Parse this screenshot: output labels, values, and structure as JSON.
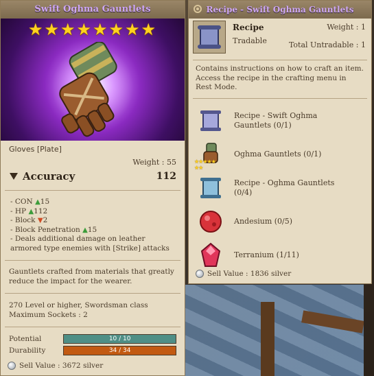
{
  "item": {
    "title": "Swift Oghma Gauntlets",
    "stars": "★★★★★★★★",
    "type": "Gloves [Plate]",
    "weight": "Weight : 55",
    "stat_name": "Accuracy",
    "stat_value": "112",
    "stats": [
      {
        "text": "- CON",
        "arrow": "▲",
        "dir": "up",
        "val": "15"
      },
      {
        "text": "- HP",
        "arrow": "▲",
        "dir": "up",
        "val": "112"
      },
      {
        "text": "- Block",
        "arrow": "▼",
        "dir": "down",
        "val": "2"
      },
      {
        "text": "- Block Penetration",
        "arrow": "▲",
        "dir": "up",
        "val": "15"
      }
    ],
    "stat_note": "- Deals additional damage on leather armored type enemies with [Strike] attacks",
    "description": "Gauntlets crafted from materials that greatly reduce the impact for the wearer.",
    "requirement": "270 Level or higher, Swordsman class",
    "sockets": "Maximum Sockets : 2",
    "potential_label": "Potential",
    "potential_value": "10 / 10",
    "potential_fraction": 1.0,
    "durability_label": "Durability",
    "durability_value": "34 / 34",
    "durability_fraction": 1.0,
    "sell_value": "Sell Value : 3672 silver"
  },
  "recipe": {
    "title": "Recipe - Swift Oghma Gauntlets",
    "name": "Recipe",
    "tradable": "Tradable",
    "weight": "Weight : 1",
    "untradable": "Total Untradable : 1",
    "description": "Contains instructions on how to craft an item. Access the recipe in the crafting menu in Rest Mode.",
    "materials": [
      {
        "icon": "scroll-icon",
        "label": "Recipe - Swift Oghma Gauntlets (0/1)"
      },
      {
        "icon": "gauntlet-icon",
        "label": "Oghma Gauntlets (0/1)"
      },
      {
        "icon": "scroll-blue-icon",
        "label": "Recipe - Oghma Gauntlets (0/4)"
      },
      {
        "icon": "andesium-icon",
        "label": "Andesium (0/5)"
      },
      {
        "icon": "terranium-icon",
        "label": "Terranium (1/11)"
      }
    ],
    "sell_value": "Sell Value : 1836 silver"
  },
  "colors": {
    "title_text": "#cfa8f2",
    "panel_bg": "#e7dcc4",
    "star": "#ffd21f",
    "stat_up": "#3c9c3a",
    "stat_down": "#d04a22",
    "potential_bar": "#4f8f86",
    "durability_bar": "#c25a12"
  }
}
